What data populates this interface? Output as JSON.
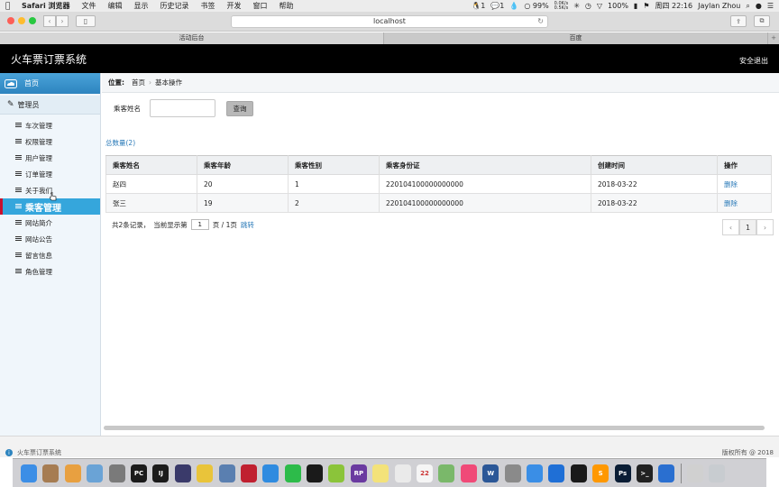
{
  "menubar": {
    "app_name": "Safari 浏览器",
    "items": [
      "文件",
      "编辑",
      "显示",
      "历史记录",
      "书签",
      "开发",
      "窗口",
      "帮助"
    ],
    "status": {
      "qq_count": "1",
      "wechat_count": "1",
      "battery": "99%",
      "net_up": "0.0K/s",
      "net_down": "0.5K/s",
      "battery_pct": "100%",
      "clock": "周四 22:16",
      "user": "Jaylan Zhou"
    }
  },
  "browser": {
    "url": "localhost",
    "tabs": [
      {
        "label": "活动后台"
      },
      {
        "label": "百度"
      }
    ]
  },
  "header": {
    "title": "火车票订票系统",
    "logout_label": "安全退出"
  },
  "sidebar": {
    "home_label": "首页",
    "section_label": "管理员",
    "items": [
      {
        "label": "车次管理"
      },
      {
        "label": "权限管理"
      },
      {
        "label": "用户管理"
      },
      {
        "label": "订单管理"
      },
      {
        "label": "关于我们"
      },
      {
        "label": "乘客管理"
      },
      {
        "label": "网站简介"
      },
      {
        "label": "网站公告"
      },
      {
        "label": "留言信息"
      },
      {
        "label": "角色管理"
      }
    ]
  },
  "breadcrumb": {
    "prefix": "位置:",
    "home": "首页",
    "current": "基本操作"
  },
  "search": {
    "label": "乘客姓名",
    "value": "",
    "button_label": "查询"
  },
  "total_label": "总数量(2)",
  "table": {
    "headers": [
      "乘客姓名",
      "乘客年龄",
      "乘客性别",
      "乘客身份证",
      "创建时间",
      "操作"
    ],
    "rows": [
      {
        "name": "赵四",
        "age": "20",
        "gender": "1",
        "id_card": "220104100000000000",
        "created": "2018-03-22",
        "action": "删除"
      },
      {
        "name": "张三",
        "age": "19",
        "gender": "2",
        "id_card": "220104100000000000",
        "created": "2018-03-22",
        "action": "删除"
      }
    ]
  },
  "pager": {
    "summary_pre": "共2条记录，",
    "current_pre": "当前显示第",
    "current_page": "1",
    "page_of": "页 / 1页",
    "jump_label": "跳转",
    "prev": "‹",
    "page_btn": "1",
    "next": "›"
  },
  "footer": {
    "left": "火车票订票系统",
    "right": "版权所有 @ 2018"
  },
  "dock": {
    "apps": [
      {
        "name": "finder",
        "color": "#3c8ee6",
        "glyph": ""
      },
      {
        "name": "notes-brown",
        "color": "#a67c52",
        "glyph": ""
      },
      {
        "name": "photos",
        "color": "#e8a040",
        "glyph": ""
      },
      {
        "name": "preview",
        "color": "#6aa3d6",
        "glyph": ""
      },
      {
        "name": "launchpad",
        "color": "#7a7a7a",
        "glyph": ""
      },
      {
        "name": "pycharm",
        "color": "#1b1b1b",
        "glyph": "PC"
      },
      {
        "name": "intellij",
        "color": "#1b1b1b",
        "glyph": "IJ"
      },
      {
        "name": "sublime-lines",
        "color": "#3a3a6a",
        "glyph": ""
      },
      {
        "name": "cyberduck",
        "color": "#e9c43a",
        "glyph": ""
      },
      {
        "name": "db-tool",
        "color": "#5a7fb0",
        "glyph": ""
      },
      {
        "name": "ruby-mine",
        "color": "#c02030",
        "glyph": ""
      },
      {
        "name": "safari",
        "color": "#2f8be0",
        "glyph": ""
      },
      {
        "name": "wechat",
        "color": "#2dbb4a",
        "glyph": ""
      },
      {
        "name": "qq",
        "color": "#1a1a1a",
        "glyph": ""
      },
      {
        "name": "green-app",
        "color": "#8bc43a",
        "glyph": ""
      },
      {
        "name": "axure-rp",
        "color": "#6a3aa0",
        "glyph": "RP"
      },
      {
        "name": "notes",
        "color": "#f3e27a",
        "glyph": ""
      },
      {
        "name": "textedit",
        "color": "#eaeaea",
        "glyph": ""
      },
      {
        "name": "calendar",
        "color": "#f5f5f5",
        "glyph": "22"
      },
      {
        "name": "maps",
        "color": "#7ab86a",
        "glyph": ""
      },
      {
        "name": "music",
        "color": "#f04a78",
        "glyph": ""
      },
      {
        "name": "word",
        "color": "#2b5797",
        "glyph": "W"
      },
      {
        "name": "system-prefs",
        "color": "#8a8a8a",
        "glyph": ""
      },
      {
        "name": "baidu-disk",
        "color": "#3a8ee6",
        "glyph": ""
      },
      {
        "name": "teamviewer",
        "color": "#1f6fd6",
        "glyph": ""
      },
      {
        "name": "qq-2",
        "color": "#1a1a1a",
        "glyph": ""
      },
      {
        "name": "sublime",
        "color": "#ff9800",
        "glyph": "S"
      },
      {
        "name": "photoshop",
        "color": "#0a1d35",
        "glyph": "Ps"
      },
      {
        "name": "terminal",
        "color": "#222",
        "glyph": ">_"
      },
      {
        "name": "browser-blue",
        "color": "#2a6fd0",
        "glyph": ""
      },
      {
        "name": "files",
        "color": "#d0d0d0",
        "glyph": ""
      },
      {
        "name": "trash",
        "color": "#c8ccd0",
        "glyph": ""
      }
    ]
  }
}
